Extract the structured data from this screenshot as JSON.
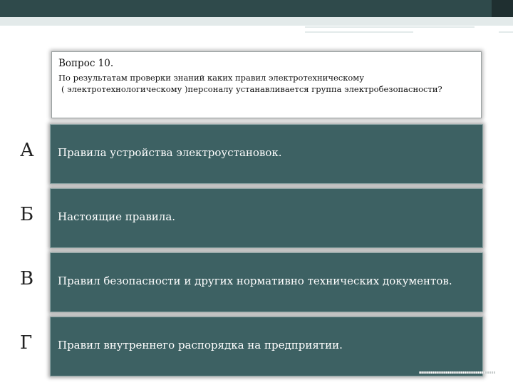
{
  "question": {
    "title": "Вопрос 10.",
    "line1": "По результатам проверки знаний каких правил электротехническому",
    "line2": "( электротехнологическому )персоналу устанавливается группа электробезопасности?"
  },
  "answers": [
    {
      "letter": "А",
      "label": "Правила устройства электроустановок."
    },
    {
      "letter": "Б",
      "label": "Настоящие правила."
    },
    {
      "letter": "В",
      "label": "Правил безопасности и других нормативно технических документов."
    },
    {
      "letter": "Г",
      "label": "Правил  внутреннего распорядка на предприятии."
    }
  ],
  "colors": {
    "top_band": "#2f4a4b",
    "answer_fill": "#3d6163",
    "answer_text": "#ffffff"
  }
}
